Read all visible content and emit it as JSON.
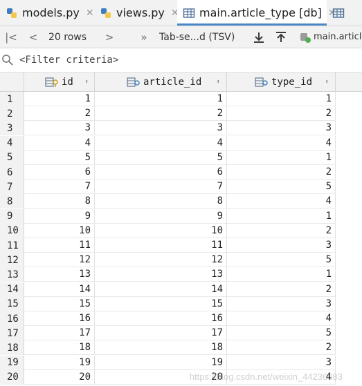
{
  "tabs": [
    {
      "label": "models.py",
      "icon": "python-file-icon",
      "close": "✕"
    },
    {
      "label": "views.py",
      "icon": "python-file-icon",
      "close": "✕"
    },
    {
      "label": "main.article_type [db]",
      "icon": "table-icon",
      "close": "✕",
      "active": true
    },
    {
      "label": "",
      "icon": "table-icon"
    }
  ],
  "toolbar": {
    "first_page": "|<",
    "prev_page": "<",
    "page_size": "20 rows",
    "next_page": ">",
    "more": "»",
    "format": "Tab-se...d (TSV)",
    "download": "download",
    "upload": "upload",
    "source_label": "main.article"
  },
  "filter": {
    "placeholder": "<Filter criteria>"
  },
  "columns": [
    "id",
    "article_id",
    "type_id"
  ],
  "sort_glyph": "⬍",
  "rows": [
    {
      "n": "1",
      "id": "1",
      "article_id": "1",
      "type_id": "1"
    },
    {
      "n": "2",
      "id": "2",
      "article_id": "2",
      "type_id": "2"
    },
    {
      "n": "3",
      "id": "3",
      "article_id": "3",
      "type_id": "3"
    },
    {
      "n": "4",
      "id": "4",
      "article_id": "4",
      "type_id": "4"
    },
    {
      "n": "5",
      "id": "5",
      "article_id": "5",
      "type_id": "1"
    },
    {
      "n": "6",
      "id": "6",
      "article_id": "6",
      "type_id": "2"
    },
    {
      "n": "7",
      "id": "7",
      "article_id": "7",
      "type_id": "5"
    },
    {
      "n": "8",
      "id": "8",
      "article_id": "8",
      "type_id": "4"
    },
    {
      "n": "9",
      "id": "9",
      "article_id": "9",
      "type_id": "1"
    },
    {
      "n": "10",
      "id": "10",
      "article_id": "10",
      "type_id": "2"
    },
    {
      "n": "11",
      "id": "11",
      "article_id": "11",
      "type_id": "3"
    },
    {
      "n": "12",
      "id": "12",
      "article_id": "12",
      "type_id": "5"
    },
    {
      "n": "13",
      "id": "13",
      "article_id": "13",
      "type_id": "1"
    },
    {
      "n": "14",
      "id": "14",
      "article_id": "14",
      "type_id": "2"
    },
    {
      "n": "15",
      "id": "15",
      "article_id": "15",
      "type_id": "3"
    },
    {
      "n": "16",
      "id": "16",
      "article_id": "16",
      "type_id": "4"
    },
    {
      "n": "17",
      "id": "17",
      "article_id": "17",
      "type_id": "5"
    },
    {
      "n": "18",
      "id": "18",
      "article_id": "18",
      "type_id": "2"
    },
    {
      "n": "19",
      "id": "19",
      "article_id": "19",
      "type_id": "3"
    },
    {
      "n": "20",
      "id": "20",
      "article_id": "20",
      "type_id": "4"
    }
  ],
  "watermark": "https://blog.csdn.net/weixin_44236083",
  "colors": {
    "accent": "#4a88c7",
    "panel": "#f2f2f2",
    "border": "#d6d6d6"
  }
}
